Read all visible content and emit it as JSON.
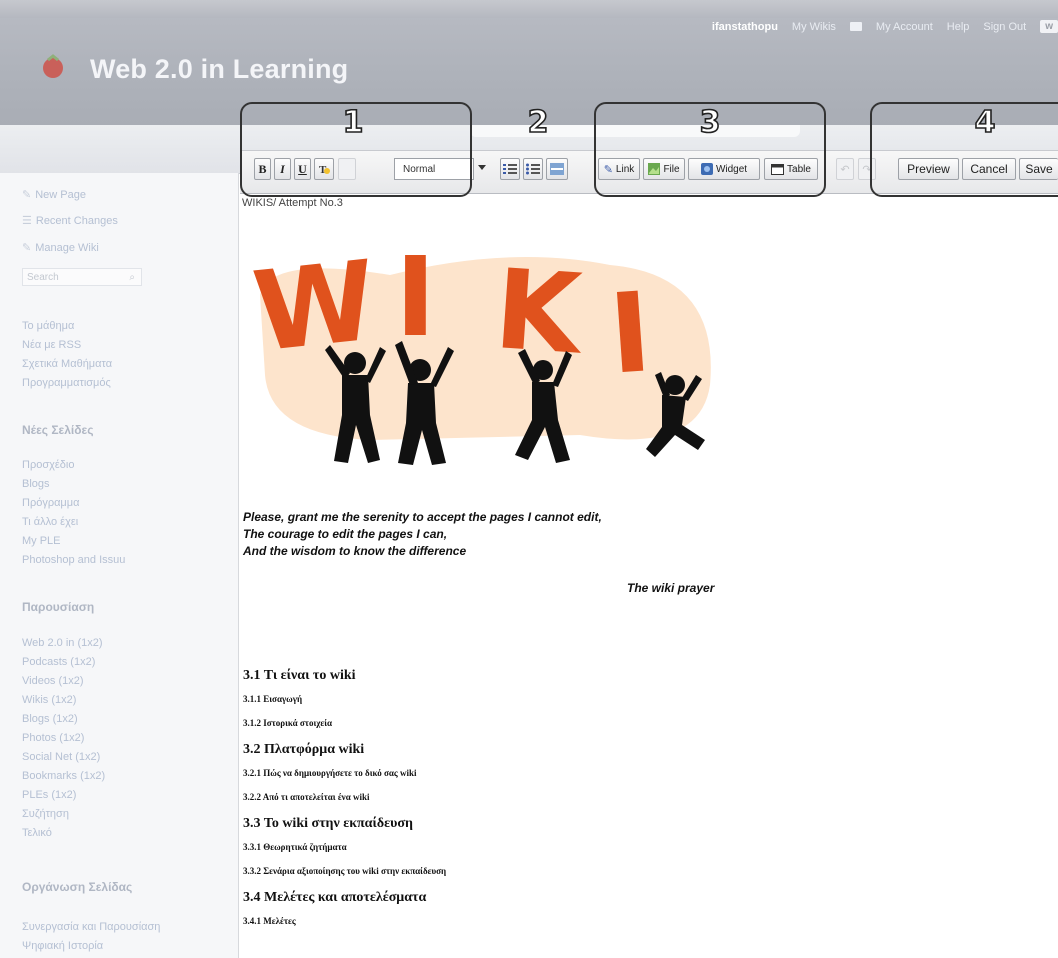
{
  "header": {
    "title": "Web 2.0 in Learning",
    "nav": {
      "user": "ifanstathopu",
      "my_wikis": "My Wikis",
      "my_account": "My Account",
      "help": "Help",
      "sign_out": "Sign Out",
      "badge": "w"
    }
  },
  "toolbar": {
    "style_value": "Normal",
    "link": "Link",
    "file": "File",
    "widget": "Widget",
    "table": "Table",
    "preview": "Preview",
    "cancel": "Cancel",
    "save": "Save"
  },
  "annotations": [
    "1",
    "2",
    "3",
    "4"
  ],
  "sidebar": {
    "actions": [
      "New Page",
      "Recent Changes",
      "Manage Wiki"
    ],
    "search_placeholder": "Search",
    "links_top": [
      "Το μάθημα",
      "Νέα με RSS",
      "Σχετικά Μαθήματα",
      "Προγραμματισμός"
    ],
    "heading_new_pages": "Νέες Σελίδες",
    "new_pages": [
      "Προσχέδιο",
      "Blogs",
      "Πρόγραμμα",
      "Τι άλλο έχει",
      "My PLE",
      "Photoshop and Issuu"
    ],
    "heading_members": "Παρουσίαση",
    "members": [
      "Web 2.0 in (1x2)",
      "Podcasts (1x2)",
      "Videos (1x2)",
      "Wikis (1x2)",
      "Blogs (1x2)",
      "Photos (1x2)",
      "Social Net (1x2)",
      "Bookmarks (1x2)",
      "PLEs (1x2)",
      "Συζήτηση",
      "Τελικό"
    ],
    "heading_more": "Οργάνωση Σελίδας",
    "more": [
      "Συνεργασία και Παρουσίαση",
      "Ψηφιακή Ιστορία"
    ]
  },
  "content": {
    "breadcrumb": "WIKIS/ Attempt No.3",
    "art_letters": [
      "W",
      "I",
      "K",
      "I"
    ],
    "prayer_lines": [
      "Please, grant me the serenity to accept the pages I cannot edit,",
      "The courage to edit the pages I can,",
      "And the wisdom to know the difference"
    ],
    "prayer_caption": "The wiki prayer",
    "toc": [
      {
        "level": 2,
        "text": "3.1 Τι είναι το wiki"
      },
      {
        "level": 3,
        "text": "3.1.1 Εισαγωγή"
      },
      {
        "level": 3,
        "text": "3.1.2 Ιστορικά στοιχεία"
      },
      {
        "level": 2,
        "text": "3.2 Πλατφόρμα wiki"
      },
      {
        "level": 3,
        "text": "3.2.1 Πώς να δημιουργήσετε το δικό σας wiki"
      },
      {
        "level": 3,
        "text": "3.2.2 Από τι αποτελείται ένα wiki"
      },
      {
        "level": 2,
        "text": "3.3 Το wiki στην εκπαίδευση"
      },
      {
        "level": 3,
        "text": "3.3.1 Θεωρητικά ζητήματα"
      },
      {
        "level": 3,
        "text": "3.3.2 Σενάρια αξιοποίησης του wiki στην εκπαίδευση"
      },
      {
        "level": 2,
        "text": "3.4 Μελέτες και αποτελέσματα"
      },
      {
        "level": 3,
        "text": "3.4.1 Μελέτες"
      }
    ]
  }
}
